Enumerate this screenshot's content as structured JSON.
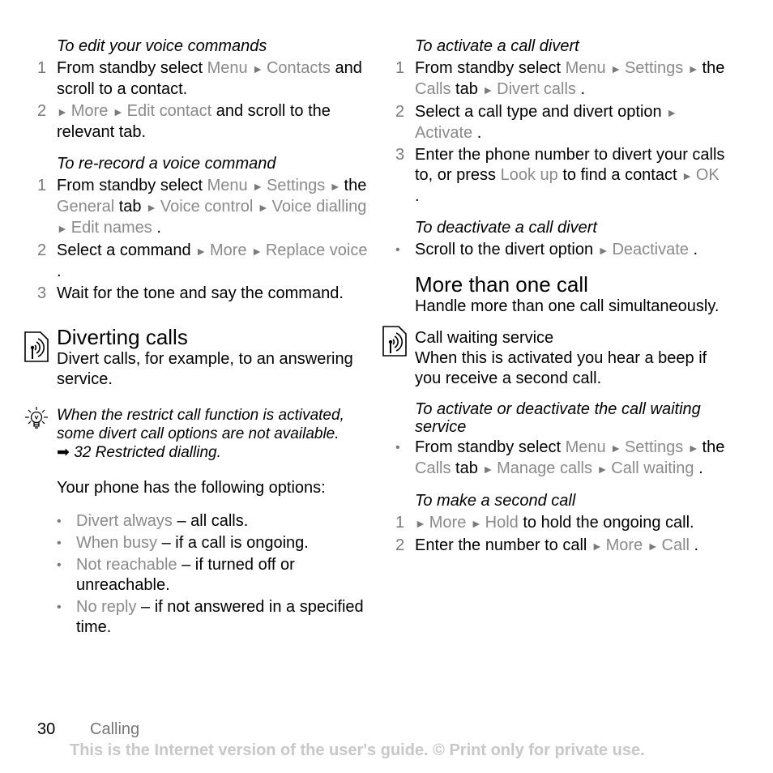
{
  "left": {
    "edit_voice": {
      "title": "To edit your voice commands",
      "steps": [
        {
          "num": "1",
          "parts": [
            [
              "t",
              "From standby select "
            ],
            [
              "m",
              "Menu"
            ],
            [
              "a",
              "►"
            ],
            [
              "m",
              "Contacts"
            ],
            [
              "t",
              " and scroll to a contact."
            ]
          ]
        },
        {
          "num": "2",
          "parts": [
            [
              "a",
              "►"
            ],
            [
              "m",
              "More"
            ],
            [
              "a",
              "►"
            ],
            [
              "m",
              "Edit contact"
            ],
            [
              "t",
              " and scroll to the relevant tab."
            ]
          ]
        }
      ]
    },
    "rerecord": {
      "title": "To re-record a voice command",
      "steps": [
        {
          "num": "1",
          "parts": [
            [
              "t",
              "From standby select "
            ],
            [
              "m",
              "Menu"
            ],
            [
              "a",
              "►"
            ],
            [
              "m",
              "Settings"
            ],
            [
              "a",
              "►"
            ],
            [
              "t",
              "the "
            ],
            [
              "m",
              "General"
            ],
            [
              "t",
              " tab "
            ],
            [
              "a",
              "►"
            ],
            [
              "m",
              "Voice control"
            ],
            [
              "a",
              "►"
            ],
            [
              "m",
              "Voice dialling"
            ],
            [
              "a",
              "►"
            ],
            [
              "m",
              "Edit names"
            ],
            [
              "t",
              "."
            ]
          ]
        },
        {
          "num": "2",
          "parts": [
            [
              "t",
              "Select a command "
            ],
            [
              "a",
              "►"
            ],
            [
              "m",
              "More"
            ],
            [
              "a",
              "►"
            ],
            [
              "m",
              "Replace voice"
            ],
            [
              "t",
              "."
            ]
          ]
        },
        {
          "num": "3",
          "parts": [
            [
              "t",
              "Wait for the tone and say the command."
            ]
          ]
        }
      ]
    },
    "diverting": {
      "heading": "Diverting calls",
      "icon": "network-service-icon",
      "description": "Divert calls, for example, to an answering service.",
      "note_icon": "lightbulb-tip-icon",
      "note": "When the restrict call function is activated, some divert call options are not available.",
      "note_ref": "32 Restricted dialling.",
      "options_intro": "Your phone has the following options:",
      "options": [
        {
          "name": "Divert always",
          "desc": " – all calls."
        },
        {
          "name": "When busy",
          "desc": " – if a call is ongoing."
        },
        {
          "name": "Not reachable",
          "desc": " – if turned off or unreachable."
        },
        {
          "name": "No reply",
          "desc": " – if not answered in a specified time."
        }
      ]
    }
  },
  "right": {
    "activate_divert": {
      "title": "To activate a call divert",
      "steps": [
        {
          "num": "1",
          "parts": [
            [
              "t",
              "From standby select "
            ],
            [
              "m",
              "Menu"
            ],
            [
              "a",
              "►"
            ],
            [
              "m",
              "Settings"
            ],
            [
              "a",
              "►"
            ],
            [
              "t",
              "the "
            ],
            [
              "m",
              "Calls"
            ],
            [
              "t",
              " tab "
            ],
            [
              "a",
              "►"
            ],
            [
              "m",
              "Divert calls"
            ],
            [
              "t",
              "."
            ]
          ]
        },
        {
          "num": "2",
          "parts": [
            [
              "t",
              "Select a call type and divert option "
            ],
            [
              "a",
              "►"
            ],
            [
              "m",
              "Activate"
            ],
            [
              "t",
              "."
            ]
          ]
        },
        {
          "num": "3",
          "parts": [
            [
              "t",
              "Enter the phone number to divert your calls to, or press "
            ],
            [
              "m",
              "Look up"
            ],
            [
              "t",
              " to find a contact "
            ],
            [
              "a",
              "►"
            ],
            [
              "m",
              "OK"
            ],
            [
              "t",
              "."
            ]
          ]
        }
      ]
    },
    "deactivate_divert": {
      "title": "To deactivate a call divert",
      "steps": [
        {
          "num": "•",
          "parts": [
            [
              "t",
              "Scroll to the divert option "
            ],
            [
              "a",
              "►"
            ],
            [
              "m",
              "Deactivate"
            ],
            [
              "t",
              "."
            ]
          ]
        }
      ]
    },
    "more_than_one": {
      "heading": "More than one call",
      "description": "Handle more than one call simultaneously."
    },
    "call_waiting": {
      "heading": "Call waiting service",
      "icon": "network-service-icon",
      "description": "When this is activated you hear a beep if you receive a second call."
    },
    "toggle_waiting": {
      "title": "To activate or deactivate the call waiting service",
      "steps": [
        {
          "num": "•",
          "parts": [
            [
              "t",
              "From standby select "
            ],
            [
              "m",
              "Menu"
            ],
            [
              "a",
              "►"
            ],
            [
              "m",
              "Settings"
            ],
            [
              "a",
              "►"
            ],
            [
              "t",
              "the "
            ],
            [
              "m",
              "Calls"
            ],
            [
              "t",
              " tab "
            ],
            [
              "a",
              "►"
            ],
            [
              "m",
              "Manage calls"
            ],
            [
              "a",
              "►"
            ],
            [
              "m",
              "Call waiting"
            ],
            [
              "t",
              "."
            ]
          ]
        }
      ]
    },
    "second_call": {
      "title": "To make a second call",
      "steps": [
        {
          "num": "1",
          "parts": [
            [
              "a",
              "►"
            ],
            [
              "m",
              "More"
            ],
            [
              "a",
              "►"
            ],
            [
              "m",
              "Hold"
            ],
            [
              "t",
              " to hold the ongoing call."
            ]
          ]
        },
        {
          "num": "2",
          "parts": [
            [
              "t",
              "Enter the number to call "
            ],
            [
              "a",
              "►"
            ],
            [
              "m",
              "More"
            ],
            [
              "a",
              "►"
            ],
            [
              "m",
              "Call"
            ],
            [
              "t",
              "."
            ]
          ]
        }
      ]
    }
  },
  "footer": {
    "page_number": "30",
    "chapter": "Calling",
    "notice": "This is the Internet version of the user's guide. © Print only for private use."
  },
  "colors": {
    "menu_item": "#8a8a8a",
    "step_number": "#7a7a7a",
    "notice": "#c8c8c8"
  }
}
